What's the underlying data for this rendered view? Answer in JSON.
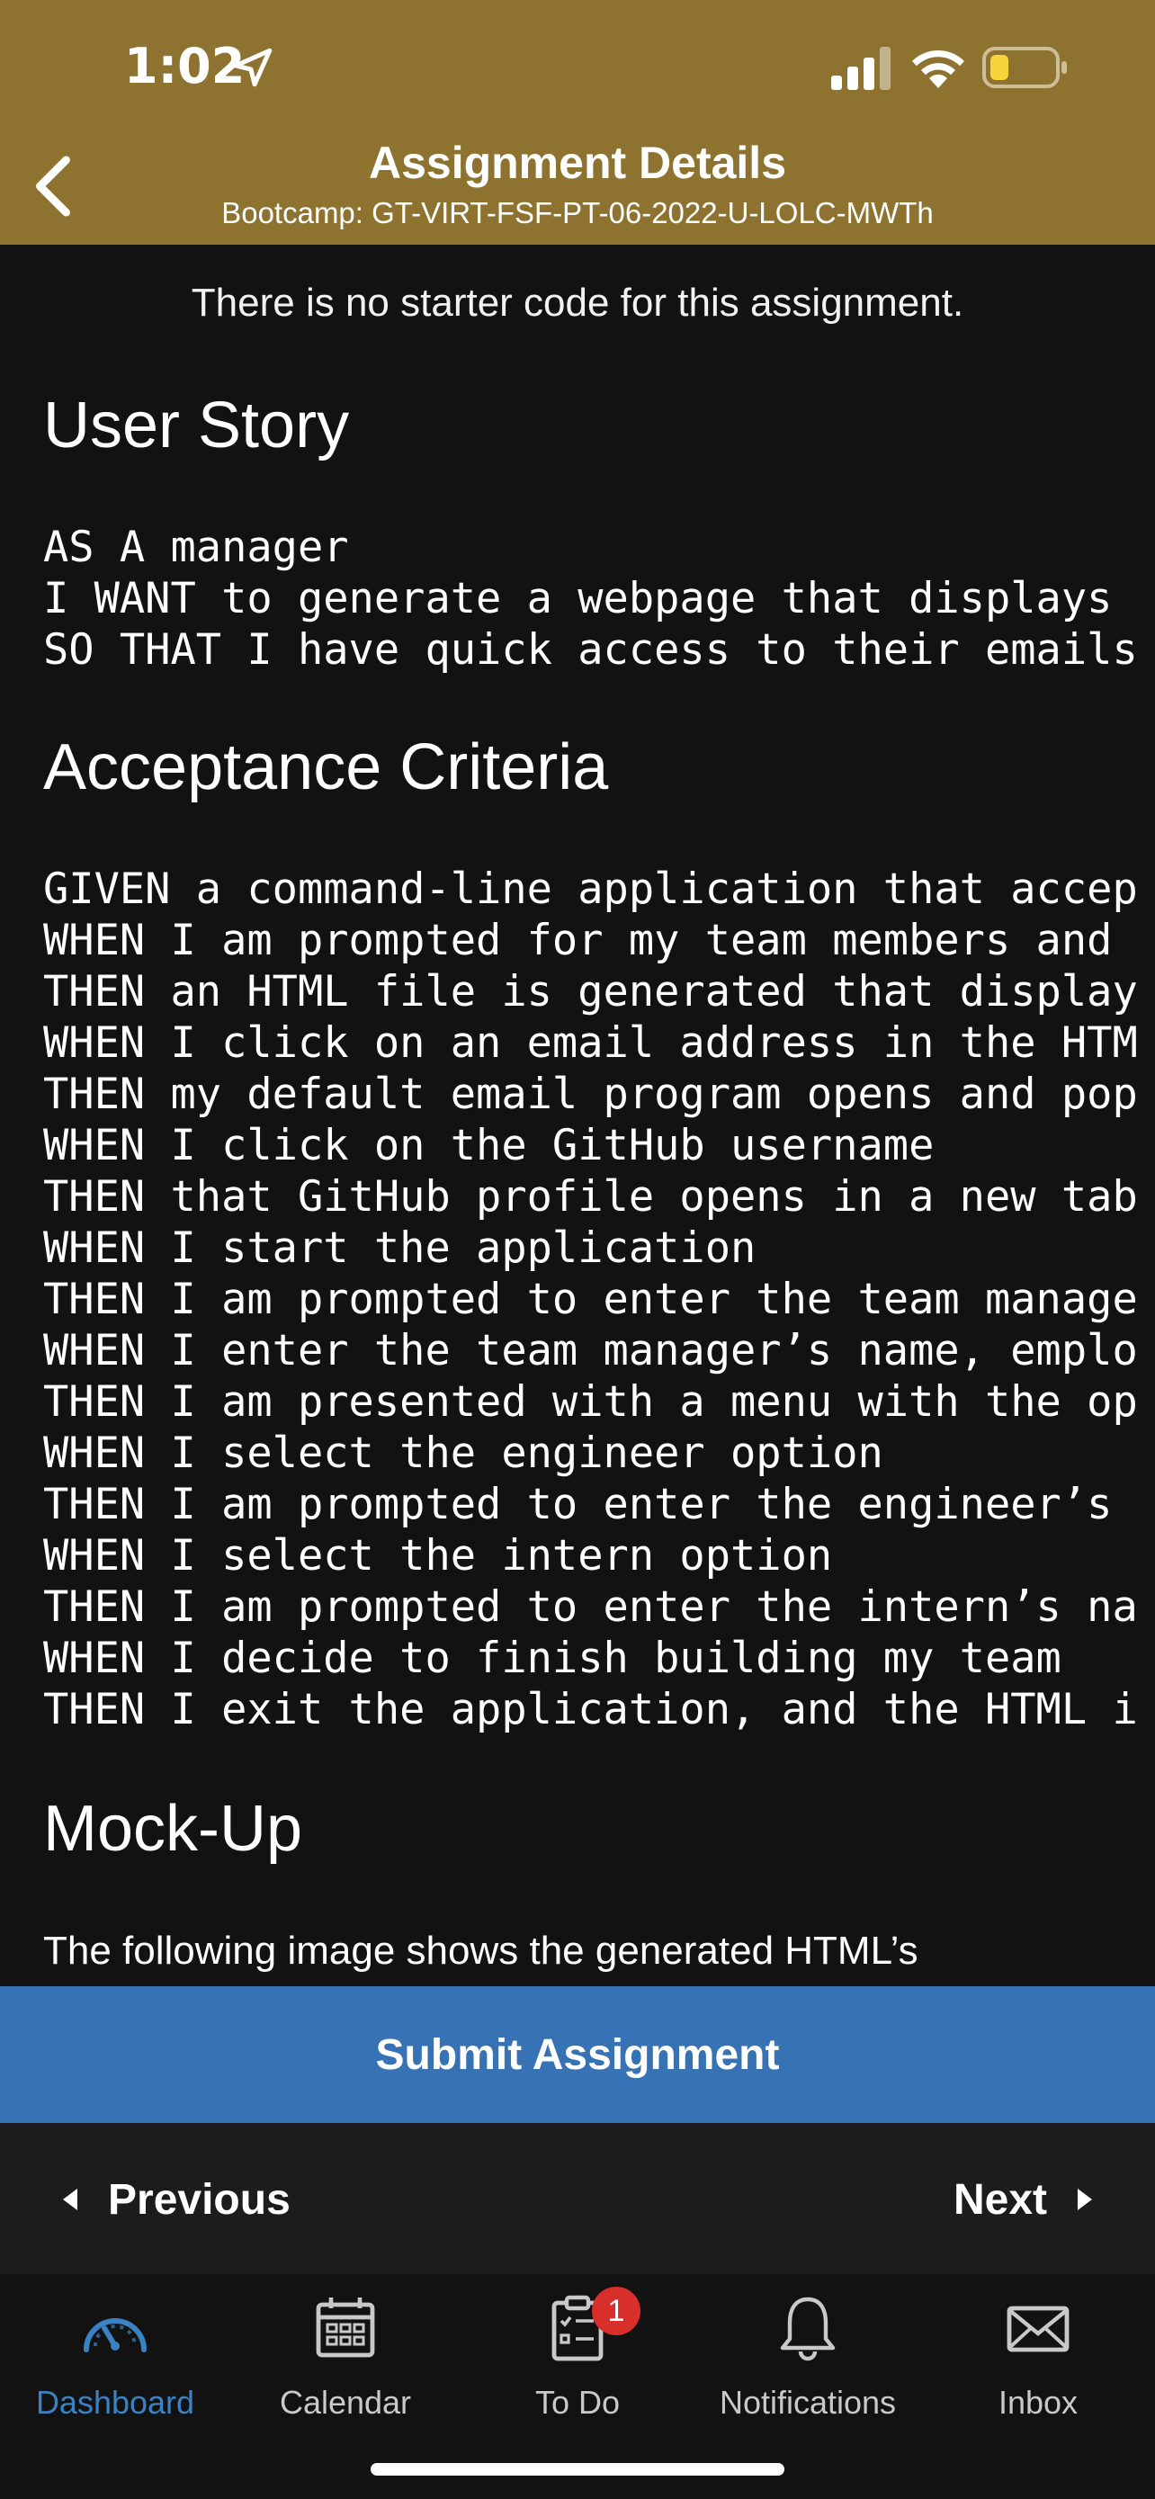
{
  "status_bar": {
    "time": "1:02"
  },
  "header": {
    "title": "Assignment Details",
    "subtitle": "Bootcamp: GT-VIRT-FSF-PT-06-2022-U-LOLC-MWTh",
    "bg_color": "#8e7330"
  },
  "content": {
    "starter_note": "There is no starter code for this assignment.",
    "user_story": {
      "heading": "User Story",
      "lines": [
        "AS A manager",
        "I WANT to generate a webpage that displays",
        "SO THAT I have quick access to their emails"
      ]
    },
    "acceptance_criteria": {
      "heading": "Acceptance Criteria",
      "lines": [
        "GIVEN a command-line application that accep",
        "WHEN I am prompted for my team members and",
        "THEN an HTML file is generated that display",
        "WHEN I click on an email address in the HTM",
        "THEN my default email program opens and pop",
        "WHEN I click on the GitHub username",
        "THEN that GitHub profile opens in a new tab",
        "WHEN I start the application",
        "THEN I am prompted to enter the team manage",
        "WHEN I enter the team manager’s name, emplo",
        "THEN I am presented with a menu with the op",
        "WHEN I select the engineer option",
        "THEN I am prompted to enter the engineer’s",
        "WHEN I select the intern option",
        "THEN I am prompted to enter the intern’s na",
        "WHEN I decide to finish building my team",
        "THEN I exit the application, and the HTML i"
      ]
    },
    "mockup": {
      "heading": "Mock-Up",
      "text": "The following image shows the generated HTML’s"
    }
  },
  "actions": {
    "submit_label": "Submit Assignment",
    "submit_color": "#3672b4",
    "previous_label": "Previous",
    "next_label": "Next"
  },
  "tabbar": {
    "active_color": "#3b82c4",
    "items": [
      {
        "label": "Dashboard",
        "icon": "dashboard-gauge-icon",
        "active": true
      },
      {
        "label": "Calendar",
        "icon": "calendar-icon",
        "active": false
      },
      {
        "label": "To Do",
        "icon": "clipboard-icon",
        "active": false,
        "badge": "1"
      },
      {
        "label": "Notifications",
        "icon": "bell-icon",
        "active": false
      },
      {
        "label": "Inbox",
        "icon": "envelope-icon",
        "active": false
      }
    ]
  }
}
